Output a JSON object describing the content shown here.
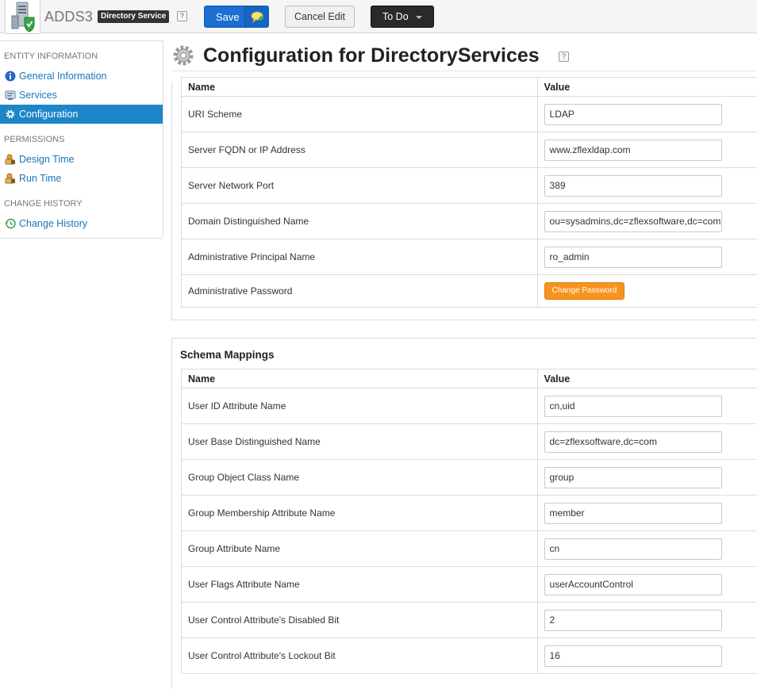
{
  "header": {
    "app_name": "ADDS3",
    "type_badge": "Directory Service",
    "help_glyph": "?",
    "save_label": "Save",
    "cancel_label": "Cancel Edit",
    "todo_label": "To Do",
    "accent_color": "#1a6fd0"
  },
  "sidebar": {
    "sections": [
      {
        "heading": "ENTITY INFORMATION",
        "items": [
          {
            "label": "General Information",
            "icon": "info-icon"
          },
          {
            "label": "Services",
            "icon": "services-icon"
          },
          {
            "label": "Configuration",
            "icon": "gear-icon",
            "active": true
          }
        ]
      },
      {
        "heading": "PERMISSIONS",
        "items": [
          {
            "label": "Design Time",
            "icon": "lock-user-icon"
          },
          {
            "label": "Run Time",
            "icon": "lock-user-icon"
          }
        ]
      },
      {
        "heading": "CHANGE HISTORY",
        "items": [
          {
            "label": "Change History",
            "icon": "history-icon"
          }
        ]
      }
    ],
    "active_color": "#1c86c8"
  },
  "page": {
    "title": "Configuration for DirectoryServices",
    "help_glyph": "?"
  },
  "connection": {
    "col_name": "Name",
    "col_value": "Value",
    "rows": [
      {
        "name": "URI Scheme",
        "value": "LDAP"
      },
      {
        "name": "Server FQDN or IP Address",
        "value": "www.zflexldap.com"
      },
      {
        "name": "Server Network Port",
        "value": "389"
      },
      {
        "name": "Domain Distinguished Name",
        "value": "ou=sysadmins,dc=zflexsoftware,dc=com"
      },
      {
        "name": "Administrative Principal Name",
        "value": "ro_admin"
      },
      {
        "name": "Administrative Password",
        "button": "Change Password"
      }
    ]
  },
  "schema": {
    "title": "Schema Mappings",
    "col_name": "Name",
    "col_value": "Value",
    "rows": [
      {
        "name": "User ID Attribute Name",
        "value": "cn,uid"
      },
      {
        "name": "User Base Distinguished Name",
        "value": "dc=zflexsoftware,dc=com"
      },
      {
        "name": "Group Object Class Name",
        "value": "group"
      },
      {
        "name": "Group Membership Attribute Name",
        "value": "member"
      },
      {
        "name": "Group Attribute Name",
        "value": "cn"
      },
      {
        "name": "User Flags Attribute Name",
        "value": "userAccountControl"
      },
      {
        "name": "User Control Attribute's Disabled Bit",
        "value": "2"
      },
      {
        "name": "User Control Attribute's Lockout Bit",
        "value": "16"
      }
    ]
  }
}
